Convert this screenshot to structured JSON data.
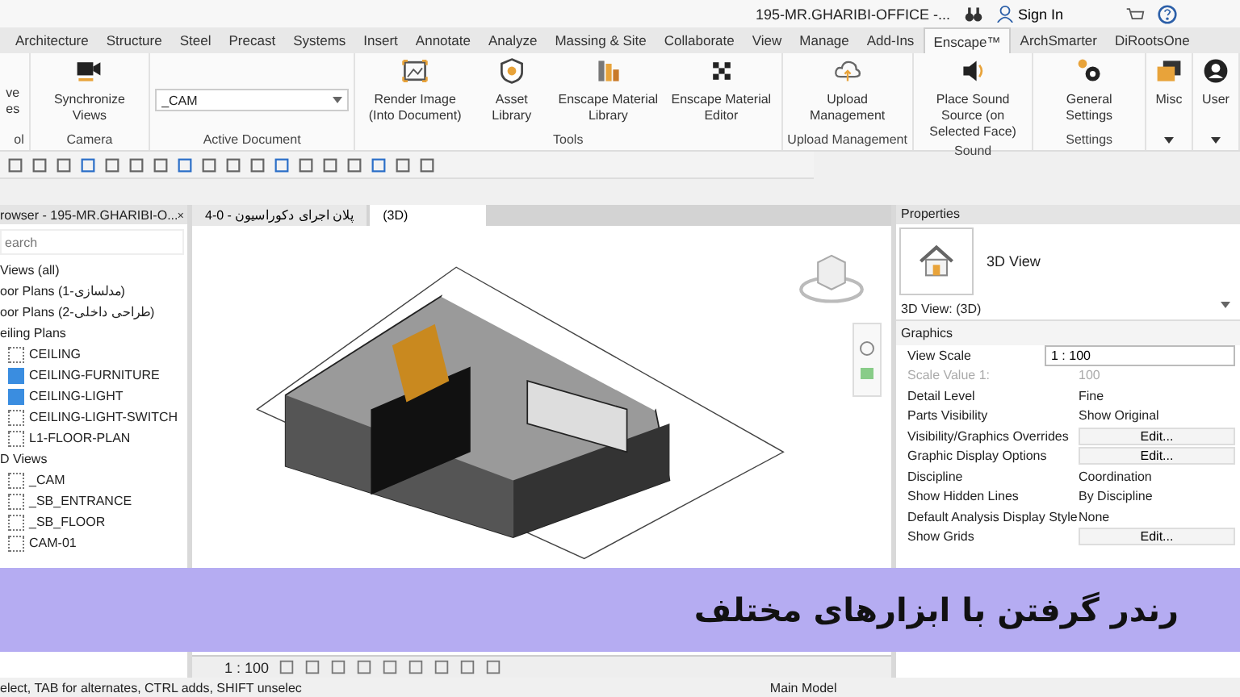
{
  "title_bar": {
    "title": "195-MR.GHARIBI-OFFICE -...",
    "sign_in": "Sign In"
  },
  "tabs": [
    {
      "label": "Architecture",
      "selected": false
    },
    {
      "label": "Structure",
      "selected": false
    },
    {
      "label": "Steel",
      "selected": false
    },
    {
      "label": "Precast",
      "selected": false
    },
    {
      "label": "Systems",
      "selected": false
    },
    {
      "label": "Insert",
      "selected": false
    },
    {
      "label": "Annotate",
      "selected": false
    },
    {
      "label": "Analyze",
      "selected": false
    },
    {
      "label": "Massing & Site",
      "selected": false
    },
    {
      "label": "Collaborate",
      "selected": false
    },
    {
      "label": "View",
      "selected": false
    },
    {
      "label": "Manage",
      "selected": false
    },
    {
      "label": "Add-Ins",
      "selected": false
    },
    {
      "label": "Enscape™",
      "selected": true
    },
    {
      "label": "ArchSmarter",
      "selected": false
    },
    {
      "label": "DiRootsOne",
      "selected": false
    }
  ],
  "ribbon": [
    {
      "label": "ol",
      "items": [
        {
          "kind": "button",
          "label": "ve es"
        }
      ]
    },
    {
      "label": "Camera",
      "items": [
        {
          "kind": "button",
          "label": "Synchronize Views"
        }
      ]
    },
    {
      "label": "Active Document",
      "items": [
        {
          "kind": "dropdown",
          "label": "_CAM"
        }
      ]
    },
    {
      "label": "Tools",
      "items": [
        {
          "kind": "button",
          "label": "Render Image (Into Document)"
        },
        {
          "kind": "button",
          "label": "Asset Library"
        },
        {
          "kind": "button",
          "label": "Enscape Material Library"
        },
        {
          "kind": "button",
          "label": "Enscape Material Editor"
        }
      ]
    },
    {
      "label": "Upload Management",
      "items": [
        {
          "kind": "button",
          "label": "Upload Management"
        }
      ]
    },
    {
      "label": "Sound",
      "items": [
        {
          "kind": "button",
          "label": "Place Sound Source (on Selected Face)"
        }
      ]
    },
    {
      "label": "Settings",
      "items": [
        {
          "kind": "button",
          "label": "General Settings"
        }
      ]
    },
    {
      "items": [
        {
          "kind": "button",
          "label": "Misc"
        }
      ]
    },
    {
      "items": [
        {
          "kind": "button",
          "label": "User"
        }
      ]
    }
  ],
  "browser": {
    "title": "rowser - 195-MR.GHARIBI-O...",
    "search_placeholder": "earch",
    "tree": [
      {
        "label": "Views (all)"
      },
      {
        "label": "oor Plans (1-مدلسازی)"
      },
      {
        "label": "oor Plans (2-طراحی داخلی)"
      },
      {
        "label": "eiling Plans",
        "children": [
          {
            "label": "CEILING",
            "marked": false
          },
          {
            "label": "CEILING-FURNITURE",
            "marked": true
          },
          {
            "label": "CEILING-LIGHT",
            "marked": true
          },
          {
            "label": "CEILING-LIGHT-SWITCH",
            "marked": false
          },
          {
            "label": "L1-FLOOR-PLAN",
            "marked": false
          }
        ]
      },
      {
        "label": "D Views",
        "children": [
          {
            "label": "_CAM",
            "marked": false
          },
          {
            "label": "_SB_ENTRANCE",
            "marked": false
          },
          {
            "label": "_SB_FLOOR",
            "marked": false
          },
          {
            "label": "CAM-01",
            "marked": false
          }
        ]
      }
    ]
  },
  "view_tabs": [
    {
      "label": "4-0 - پلان اجرای دکوراسیون",
      "selected": false
    },
    {
      "label": "(3D)",
      "selected": true
    }
  ],
  "view_scale": "1 : 100",
  "properties": {
    "title": "Properties",
    "type_name": "3D View",
    "selector": "3D View: (3D)",
    "section": "Graphics",
    "rows": [
      {
        "kind": "field",
        "label": "View Scale",
        "value": "1 : 100"
      },
      {
        "kind": "muted",
        "label": "Scale Value    1:",
        "value": "100"
      },
      {
        "kind": "text",
        "label": "Detail Level",
        "value": "Fine"
      },
      {
        "kind": "text",
        "label": "Parts Visibility",
        "value": "Show Original"
      },
      {
        "kind": "button",
        "label": "Visibility/Graphics Overrides",
        "value": "Edit..."
      },
      {
        "kind": "button",
        "label": "Graphic Display Options",
        "value": "Edit..."
      },
      {
        "kind": "text",
        "label": "Discipline",
        "value": "Coordination"
      },
      {
        "kind": "text",
        "label": "Show Hidden Lines",
        "value": "By Discipline"
      },
      {
        "kind": "text",
        "label": "Default Analysis Display Style",
        "value": "None"
      },
      {
        "kind": "button",
        "label": "Show Grids",
        "value": "Edit..."
      }
    ]
  },
  "title_overlay": "رندر گرفتن با ابزارهای مختلف",
  "status_bar": {
    "message": "elect, TAB for alternates, CTRL adds, SHIFT unselec",
    "model": "Main Model"
  }
}
